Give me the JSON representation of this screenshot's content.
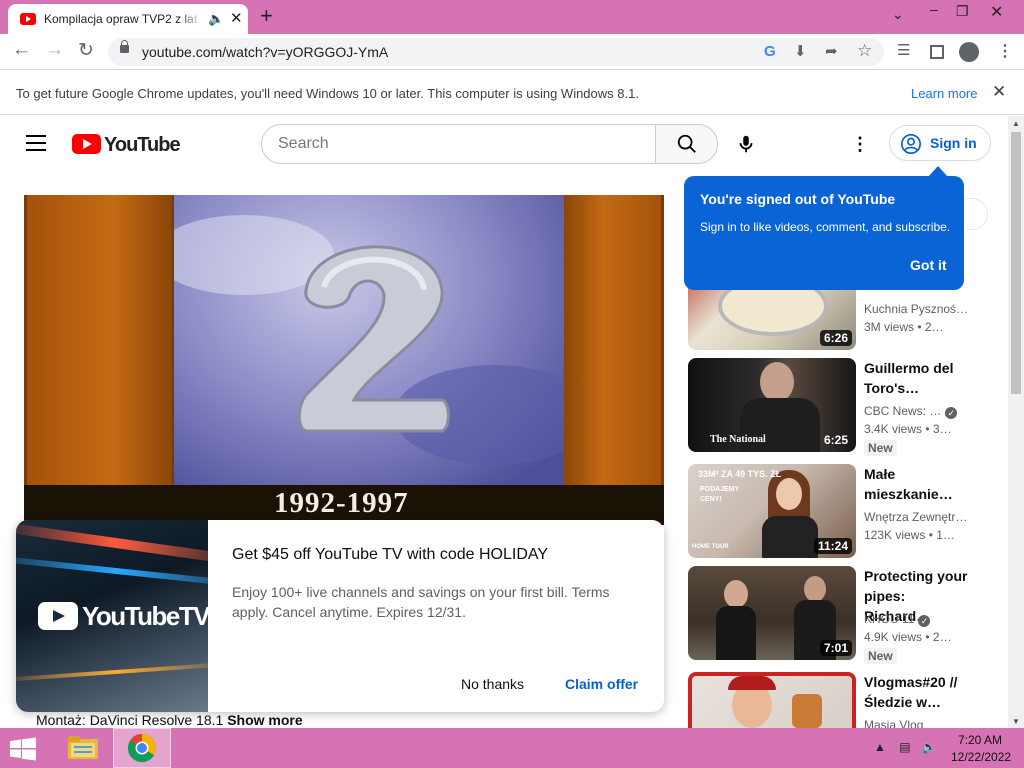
{
  "browser": {
    "tab_title": "Kompilacja opraw TVP2 z lat",
    "url": "youtube.com/watch?v=yORGGOJ-YmA",
    "infobar_message": "To get future Google Chrome updates, you'll need Windows 10 or later. This computer is using Windows 8.1.",
    "infobar_link": "Learn more"
  },
  "youtube": {
    "logo_text": "YouTube",
    "search_placeholder": "Search",
    "sign_in_label": "Sign in"
  },
  "tooltip": {
    "title": "You're signed out of YouTube",
    "body": "Sign in to like videos, comment, and subscribe.",
    "action": "Got it"
  },
  "player": {
    "overlay_text": "1992-1997"
  },
  "promo": {
    "logo_text": "YouTubeTV",
    "title": "Get $45 off YouTube TV with code HOLIDAY",
    "body": "Enjoy 100+ live channels and savings on your first bill. Terms apply. Cancel anytime. Expires 12/31.",
    "decline": "No thanks",
    "accept": "Claim offer"
  },
  "description": {
    "text": "Montaż: DaVinci Resolve 18.1",
    "more": "Show more"
  },
  "recommendations": [
    {
      "title": "",
      "channel": "Kuchnia Pysznoś…",
      "views": "3M views  • 2…",
      "duration": "6:26",
      "verified": false,
      "badge": ""
    },
    {
      "title": "Guillermo del Toro's…",
      "channel": "CBC News: …",
      "views": "3.4K views  • 3…",
      "duration": "6:25",
      "verified": true,
      "badge": "New",
      "thumb_text": "The National"
    },
    {
      "title": "Małe mieszkanie…",
      "channel": "Wnętrza Zewnętr…",
      "views": "123K views  • 1…",
      "duration": "11:24",
      "verified": false,
      "badge": "",
      "thumb_text": "33M² ZA 49 TYS. ZŁ",
      "thumb_text2": "PODAJEMY CENY!",
      "thumb_text3": "HOME TOUR"
    },
    {
      "title": "Protecting your pipes: Richard…",
      "channel": "KHOU 11",
      "views": "4.9K views  • 2…",
      "duration": "7:01",
      "verified": true,
      "badge": "New"
    },
    {
      "title": "Vlogmas#20 // Śledzie w…",
      "channel": "Masia Vlog",
      "views": "",
      "duration": "",
      "verified": false,
      "badge": ""
    }
  ],
  "taskbar": {
    "time": "7:20 AM",
    "date": "12/22/2022"
  }
}
